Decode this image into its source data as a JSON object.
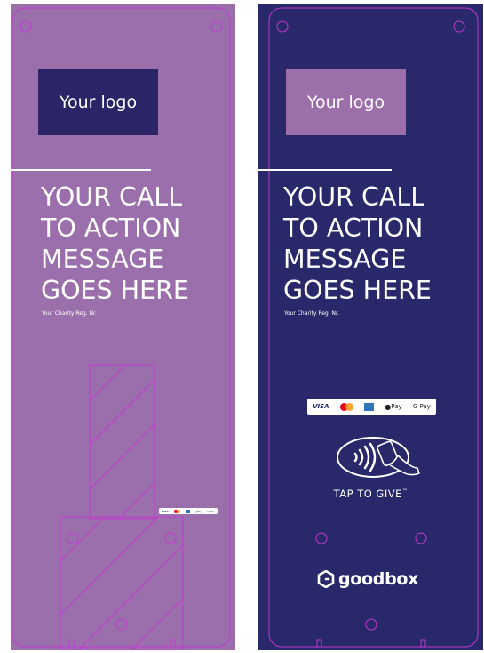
{
  "left_panel": {
    "logo": "Your logo",
    "cta_lines": [
      "YOUR CALL",
      "TO ACTION",
      "MESSAGE",
      "GOES HERE"
    ],
    "reg": "Your Charity Reg. Nr.",
    "payments": {
      "visa": "VISA",
      "applepay": "Pay",
      "gpay": "G Pay"
    }
  },
  "right_panel": {
    "logo": "Your logo",
    "cta_lines": [
      "YOUR CALL",
      "TO ACTION",
      "MESSAGE",
      "GOES HERE"
    ],
    "reg": "Your Charity Reg. Nr.",
    "payments": {
      "visa": "VISA",
      "applepay": "Pay",
      "gpay": "G Pay"
    },
    "tap_label": "TAP TO GIVE",
    "tap_tm": "™",
    "brand": "goodbox"
  },
  "colors": {
    "left_bg": "#9a6fab",
    "right_bg": "#29286a",
    "outline": "#c23ad0"
  },
  "icons": [
    "contactless-hand-icon",
    "goodbox-logo-icon",
    "mastercard-icon",
    "amex-icon"
  ]
}
